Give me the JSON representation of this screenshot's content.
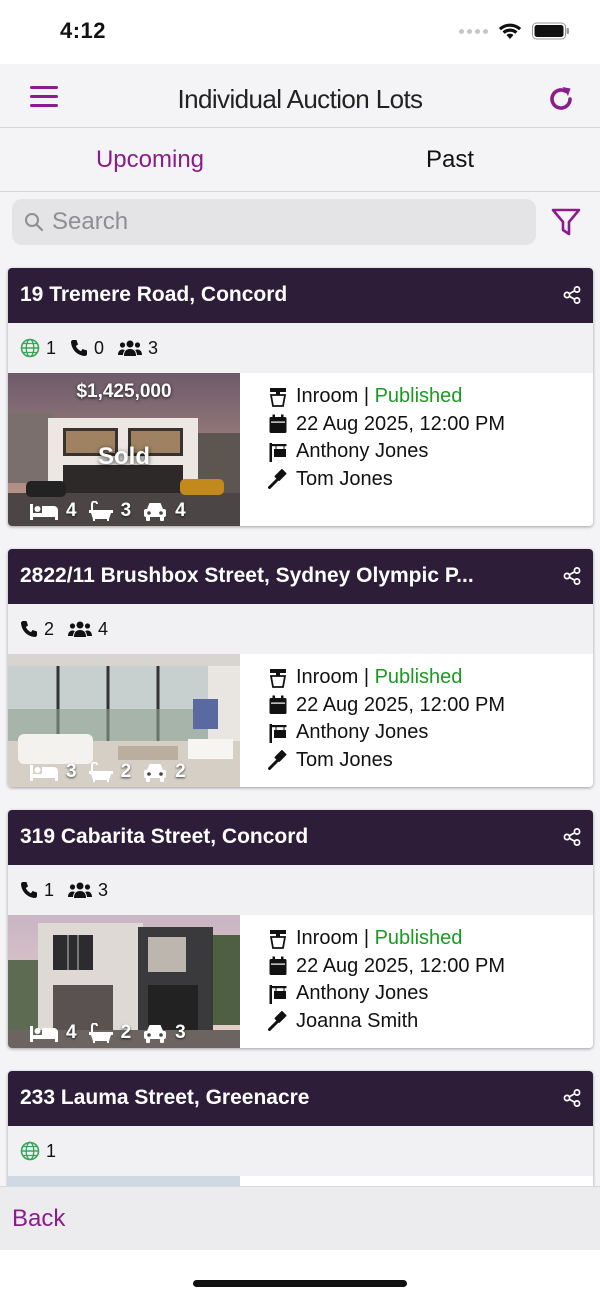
{
  "status_bar": {
    "time": "4:12"
  },
  "header": {
    "title": "Individual Auction Lots"
  },
  "tabs": [
    {
      "label": "Upcoming",
      "active": true
    },
    {
      "label": "Past",
      "active": false
    }
  ],
  "search": {
    "placeholder": "Search",
    "value": ""
  },
  "colors": {
    "accent": "#8b1c8d",
    "card_header": "#2d1d38",
    "published": "#1a9a22"
  },
  "lots": [
    {
      "address": "19 Tremere Road, Concord",
      "stats": {
        "web": "1",
        "phone": "0",
        "people": "3"
      },
      "price": "$1,425,000",
      "status_overlay": "Sold",
      "beds": "4",
      "baths": "3",
      "cars": "4",
      "type": "Inroom",
      "separator": "|",
      "state": "Published",
      "date": "22 Aug 2025, 12:00 PM",
      "agent": "Anthony Jones",
      "auctioneer": "Tom Jones"
    },
    {
      "address": "2822/11 Brushbox Street, Sydney Olympic P...",
      "stats": {
        "phone": "2",
        "people": "4"
      },
      "beds": "3",
      "baths": "2",
      "cars": "2",
      "type": "Inroom",
      "separator": "|",
      "state": "Published",
      "date": "22 Aug 2025, 12:00 PM",
      "agent": "Anthony Jones",
      "auctioneer": "Tom Jones"
    },
    {
      "address": "319 Cabarita Street, Concord",
      "stats": {
        "phone": "1",
        "people": "3"
      },
      "beds": "4",
      "baths": "2",
      "cars": "3",
      "type": "Inroom",
      "separator": "|",
      "state": "Published",
      "date": "22 Aug 2025, 12:00 PM",
      "agent": "Anthony Jones",
      "auctioneer": "Joanna Smith"
    },
    {
      "address": "233 Lauma Street, Greenacre",
      "stats": {
        "web": "1"
      }
    }
  ],
  "footer": {
    "back_label": "Back"
  },
  "icons": [
    "menu-icon",
    "refresh-icon",
    "search-icon",
    "filter-icon",
    "share-icon",
    "globe-icon",
    "phone-icon",
    "people-icon",
    "bed-icon",
    "bath-icon",
    "car-icon",
    "gavel-stand-icon",
    "calendar-icon",
    "sign-icon",
    "gavel-icon"
  ]
}
